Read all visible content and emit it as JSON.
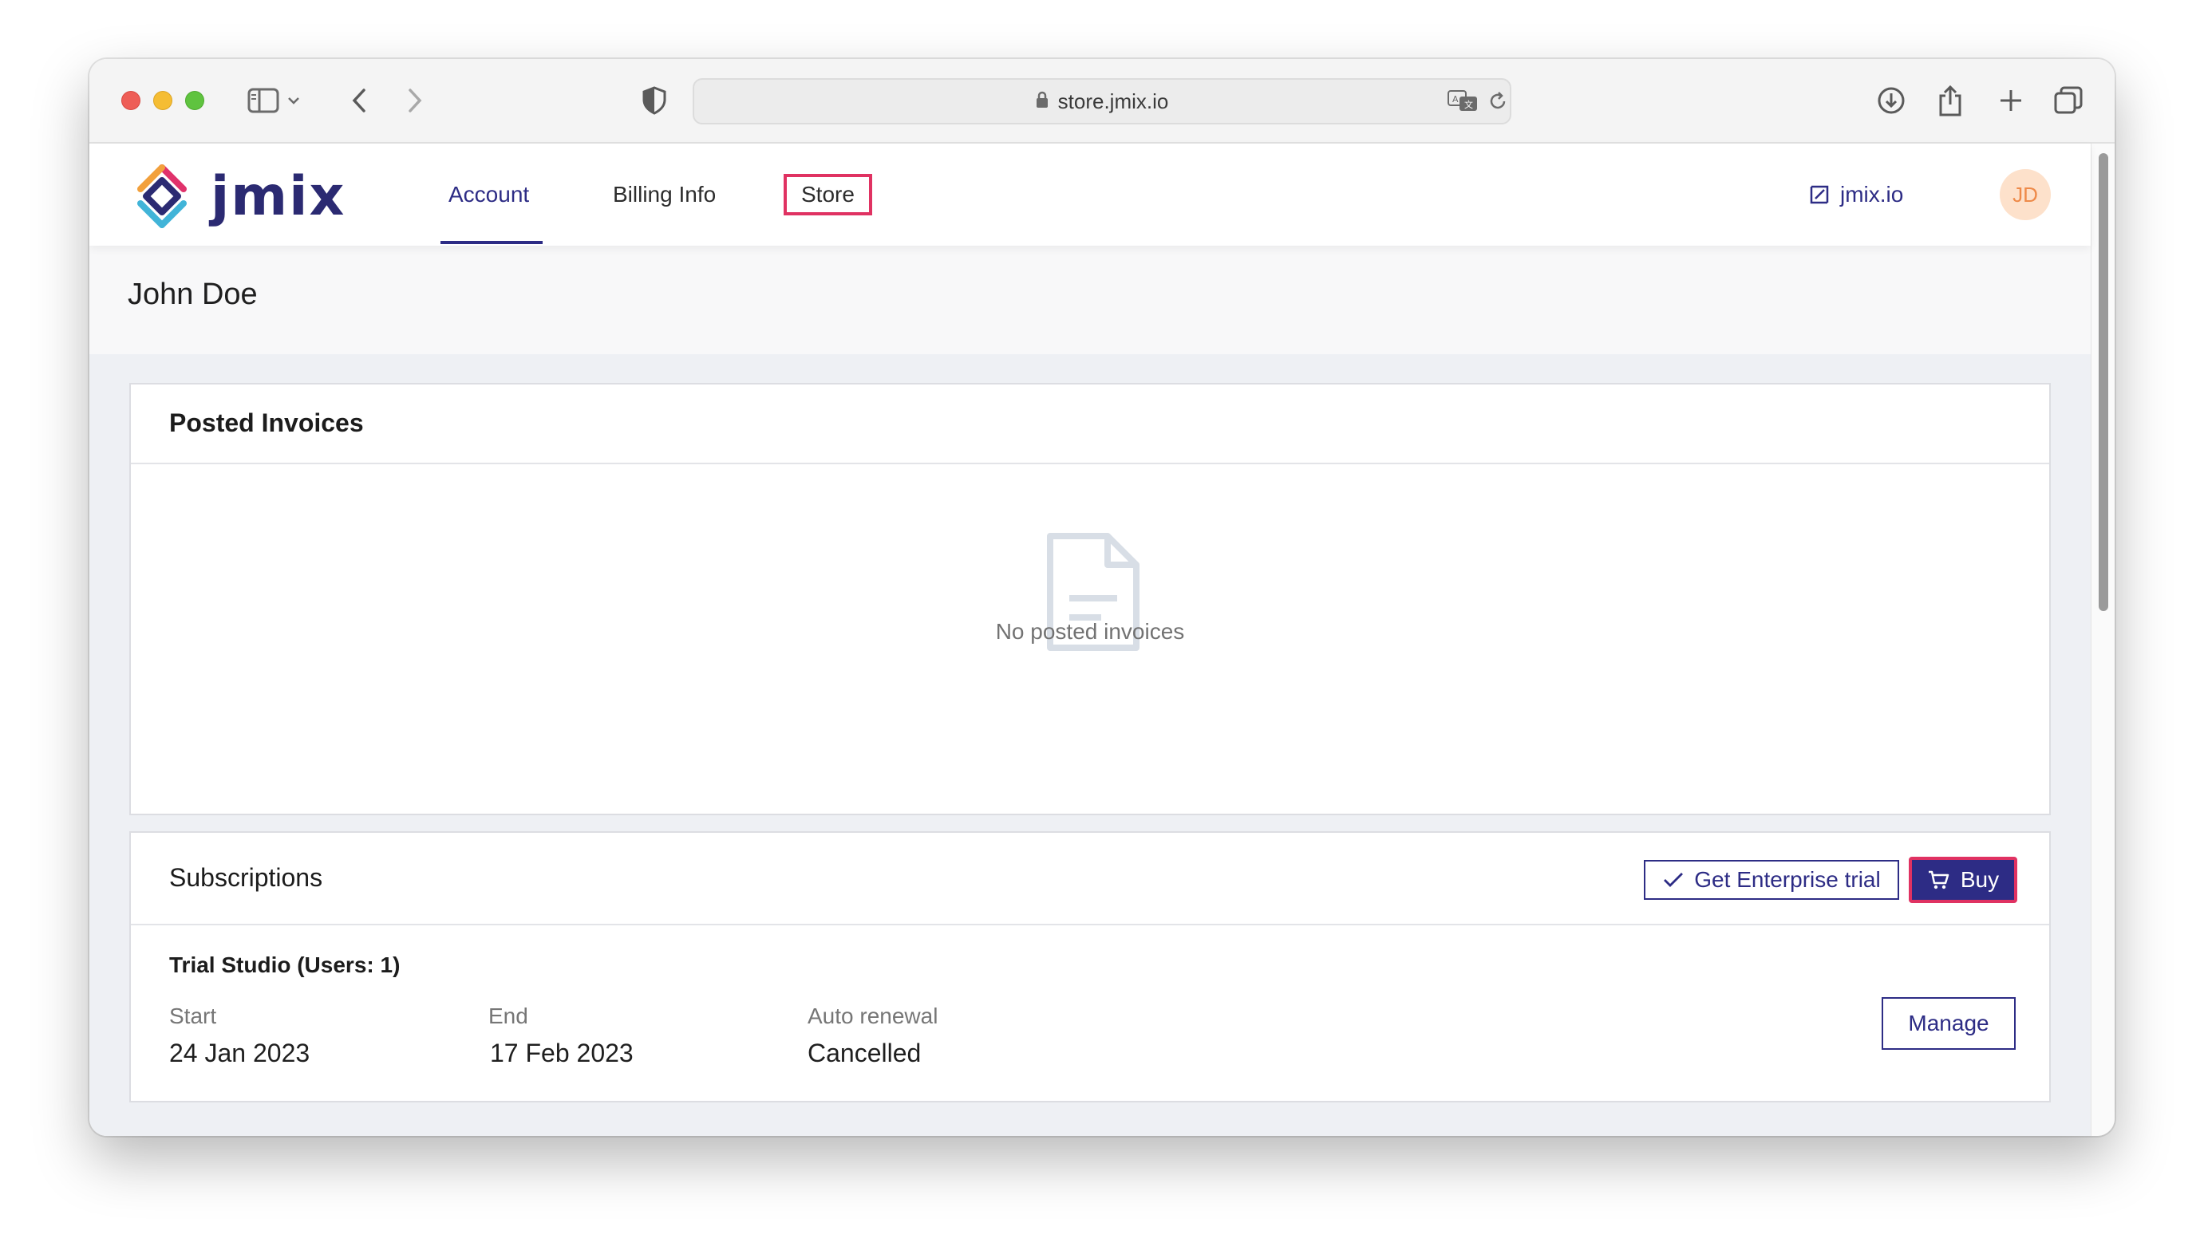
{
  "browser": {
    "url": "store.jmix.io",
    "traffic_lights": [
      "close",
      "minimize",
      "maximize"
    ]
  },
  "app": {
    "logo_text": "jmix",
    "nav": {
      "account": "Account",
      "billing": "Billing Info",
      "store": "Store",
      "active": "Account"
    },
    "external_link": "jmix.io",
    "avatar_initials": "JD",
    "colors": {
      "brand": "#2d2c85",
      "highlight": "#e03262",
      "avatar_bg": "#fde1cb",
      "avatar_fg": "#ee8a49"
    }
  },
  "user": {
    "name": "John Doe"
  },
  "invoices": {
    "title": "Posted Invoices",
    "empty_text": "No posted invoices"
  },
  "subscriptions": {
    "title": "Subscriptions",
    "trial_button": "Get Enterprise trial",
    "buy_button": "Buy",
    "items": [
      {
        "name": "Trial Studio (Users: 1)",
        "start_label": "Start",
        "start_value": "24 Jan 2023",
        "end_label": "End",
        "end_value": "17 Feb 2023",
        "renewal_label": "Auto renewal",
        "renewal_value": "Cancelled",
        "manage_button": "Manage"
      }
    ]
  }
}
